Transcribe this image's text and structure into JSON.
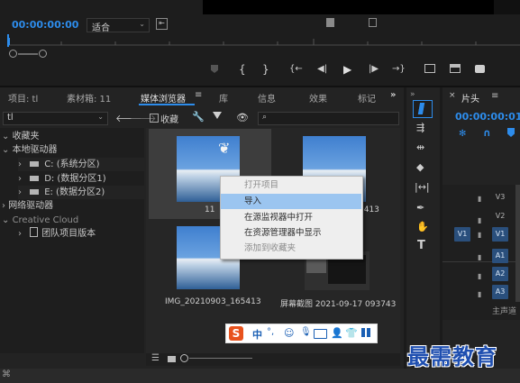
{
  "monitor": {
    "timecode": "00:00:00:00",
    "zoom": "适合"
  },
  "panel": {
    "tabs": [
      {
        "label": "项目: tl"
      },
      {
        "label": "素材箱: 11"
      },
      {
        "label": "媒体浏览器"
      },
      {
        "label": "库"
      },
      {
        "label": "信息"
      },
      {
        "label": "效果"
      },
      {
        "label": "标记"
      }
    ],
    "path_value": "tl",
    "favorites_label": "收藏",
    "search_placeholder": ""
  },
  "tree": {
    "favorites": "收藏夹",
    "local_drives": "本地驱动器",
    "drive_c": "C: (系统分区)",
    "drive_d": "D: (数据分区1)",
    "drive_e": "E: (数据分区2)",
    "network_drives": "网络驱动器",
    "creative_cloud": "Creative Cloud",
    "team_projects": "团队项目版本"
  },
  "media": [
    {
      "label": "11"
    },
    {
      "label": "5413"
    },
    {
      "label": "IMG_20210903_165413"
    },
    {
      "label": "屏幕截图 2021-09-17 093743"
    }
  ],
  "context_menu": {
    "items": [
      {
        "label": "打开项目",
        "state": "disabled"
      },
      {
        "label": "导入",
        "state": "highlighted"
      },
      {
        "label": "在源监视器中打开",
        "state": "normal"
      },
      {
        "label": "在资源管理器中显示",
        "state": "normal"
      },
      {
        "label": "添加到收藏夹",
        "state": "disabled"
      }
    ]
  },
  "ime": {
    "mode": "中",
    "punct": "°,"
  },
  "timeline": {
    "tab_label": "片头",
    "timecode": "00:00:00:01",
    "source_patch": "V1",
    "tracks": [
      {
        "target": "V3",
        "kind": "video"
      },
      {
        "target": "V2",
        "kind": "video"
      },
      {
        "target": "V1",
        "kind": "video"
      },
      {
        "target": "A1",
        "kind": "audio"
      },
      {
        "target": "A2",
        "kind": "audio"
      },
      {
        "target": "A3",
        "kind": "audio"
      }
    ],
    "master_label": "主声道"
  },
  "watermark": "最需教育",
  "colors": {
    "accent": "#2d8ceb",
    "menu_bg": "#eeeeee",
    "menu_highlight": "#9bc5f0",
    "track_blue": "#2a4f7c"
  }
}
